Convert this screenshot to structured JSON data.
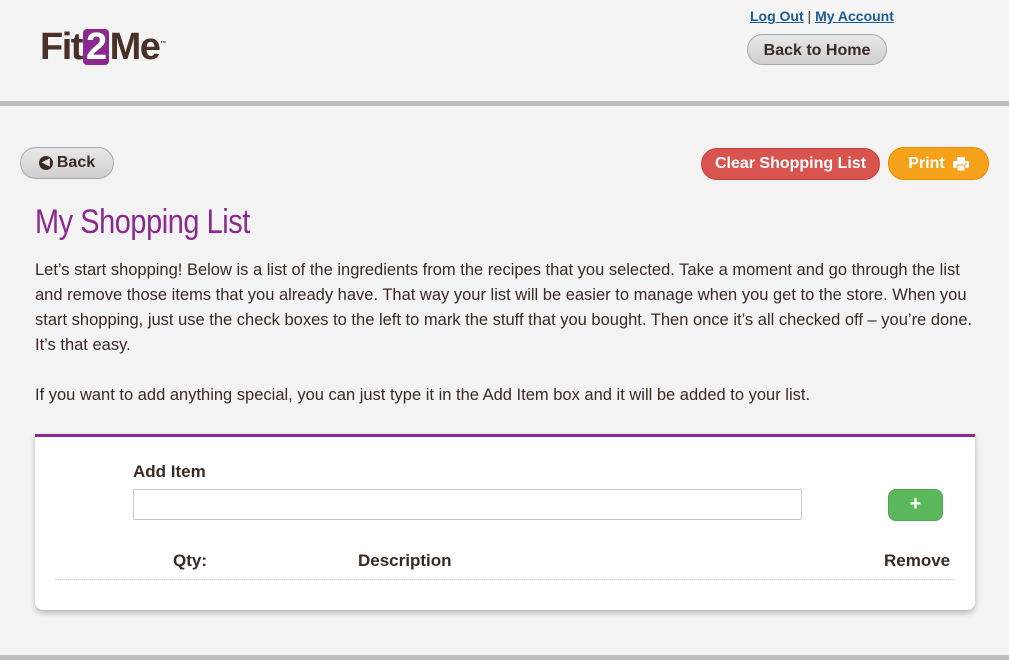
{
  "header": {
    "logo_prefix": "Fit",
    "logo_two": "2",
    "logo_suffix": "Me",
    "logo_tm": "™",
    "logout_label": "Log Out",
    "separator": "|",
    "account_label": "My Account",
    "home_button_label": "Back to Home"
  },
  "toolbar": {
    "back_label": "Back",
    "back_icon": "arrow-circle-left-icon",
    "clear_label": "Clear Shopping List",
    "print_label": "Print",
    "print_icon": "printer-icon"
  },
  "page": {
    "title": "My Shopping List",
    "intro_paragraph_1": "Let’s start shopping! Below is a list of the ingredients from the recipes that you selected. Take a moment and go through the list and remove those items that you already have. That way your list will be easier to manage when you get to the store. When you start shopping, just use the check boxes to the left to mark the stuff that you bought. Then once it’s all checked off – you’re done. It’s that easy.",
    "intro_paragraph_2": "If you want to add anything special, you can just type it in the Add Item box and it will be added to your list."
  },
  "add_item": {
    "label": "Add Item",
    "value": "",
    "placeholder": "",
    "button_symbol": "+"
  },
  "table": {
    "columns": [
      "Qty:",
      "Description",
      "Remove"
    ]
  },
  "colors": {
    "brand_purple": "#8a2a8f",
    "clear_red": "#d9534f",
    "print_orange": "#f5a21a",
    "add_green": "#5cb85c"
  }
}
